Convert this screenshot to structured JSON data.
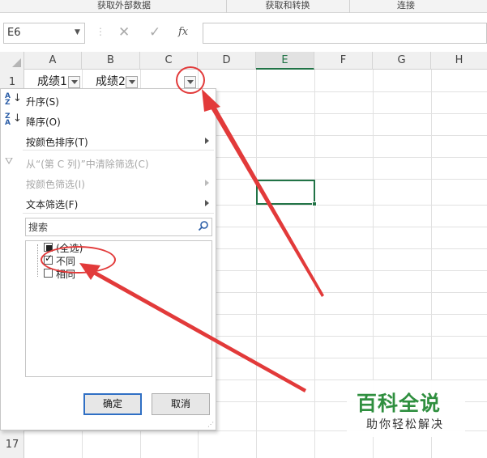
{
  "ribbon": {
    "groups": [
      "获取外部数据",
      "获取和转换",
      "连接"
    ]
  },
  "formula_bar": {
    "name_box": "E6",
    "fx_label": "fx",
    "formula": ""
  },
  "grid": {
    "columns": [
      "A",
      "B",
      "C",
      "D",
      "E",
      "F",
      "G",
      "H"
    ],
    "selected_column": "E",
    "rows": [
      "1",
      "17"
    ],
    "cells": {
      "A1": "成绩1",
      "B1": "成绩2"
    }
  },
  "filter_menu": {
    "sort_asc": "升序(S)",
    "sort_desc": "降序(O)",
    "sort_by_color": "按颜色排序(T)",
    "clear_filter": "从“(第 C 列)”中清除筛选(C)",
    "filter_by_color": "按颜色筛选(I)",
    "text_filter": "文本筛选(F)",
    "search_placeholder": "搜索",
    "list_items": [
      {
        "label": "(全选)",
        "state": "partial"
      },
      {
        "label": "不同",
        "state": "checked"
      },
      {
        "label": "相同",
        "state": "unchecked"
      }
    ],
    "ok_label": "确定",
    "cancel_label": "取消"
  },
  "icons": {
    "sort_asc": "sort-ascending-icon",
    "sort_desc": "sort-descending-icon",
    "clear_filter": "funnel-clear-icon",
    "search": "magnifier-icon"
  },
  "annotation": {
    "color": "#e23a3a"
  },
  "watermark": {
    "title": "百科全说",
    "subtitle": "助你轻松解决",
    "color": "#2f8f3f"
  }
}
